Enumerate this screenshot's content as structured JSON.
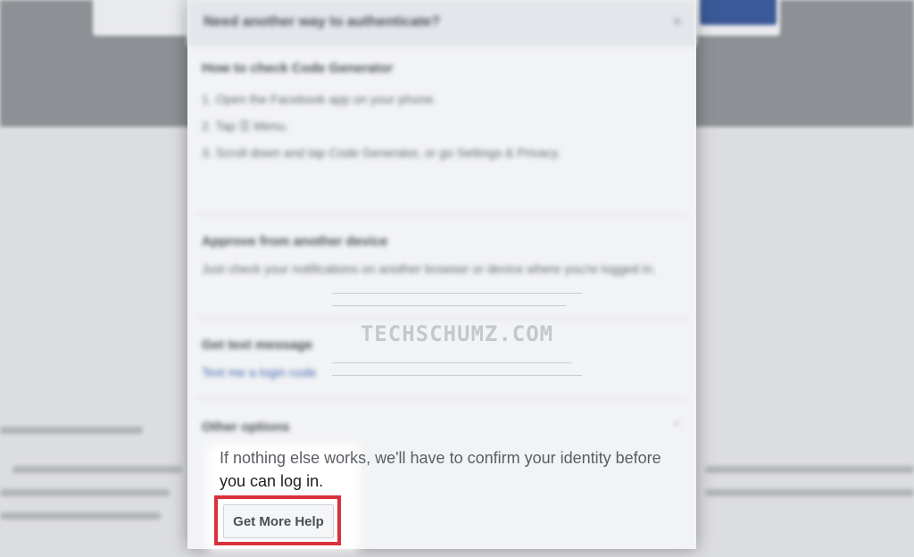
{
  "modal": {
    "title": "Need another way to authenticate?",
    "close_glyph": "×",
    "section_code_generator": {
      "title": "How to check Code Generator",
      "steps": [
        "1. Open the Facebook app on your phone.",
        "2. Tap ☰ Menu.",
        "3. Scroll down and tap Code Generator, or go Settings & Privacy."
      ]
    },
    "section_approve": {
      "title": "Approve from another device",
      "text": "Just check your notifications on another browser or device where you're logged in."
    },
    "section_text_message": {
      "title": "Get text message",
      "link": "Text me a login code"
    },
    "section_other": {
      "title": "Other options",
      "text_line1": "If nothing else works, we'll have to confirm your identity before",
      "text_line2": "you can log in."
    },
    "get_help_button": "Get More Help"
  },
  "watermark": "TECHSCHUMZ.COM",
  "colors": {
    "highlight_border": "#d9323c",
    "link": "#4267b2",
    "brand_button": "#3b5998"
  }
}
